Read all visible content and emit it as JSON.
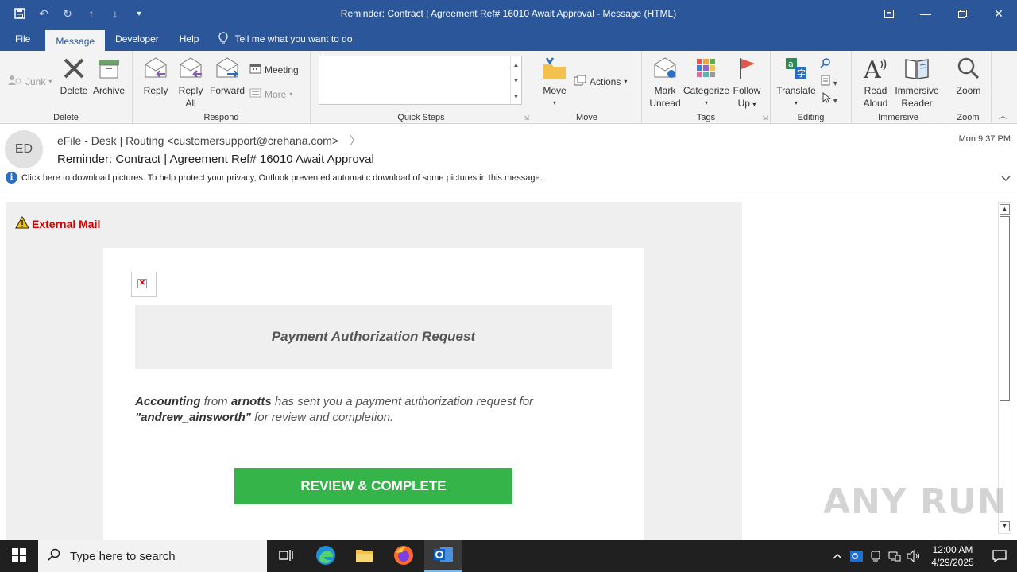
{
  "window": {
    "title": "Reminder:  Contract | Agreement Ref# 16010 Await Approval  -  Message (HTML)"
  },
  "ribbon_tabs": [
    "File",
    "Message",
    "Developer",
    "Help"
  ],
  "tell_me": "Tell me what you want to do",
  "ribbon": {
    "delete_group": {
      "label": "Delete",
      "junk": "Junk",
      "delete": "Delete",
      "archive": "Archive"
    },
    "respond_group": {
      "label": "Respond",
      "reply": "Reply",
      "reply_all_line1": "Reply",
      "reply_all_line2": "All",
      "forward": "Forward",
      "meeting": "Meeting",
      "more": "More"
    },
    "quick_steps_group": {
      "label": "Quick Steps"
    },
    "move_group": {
      "label": "Move",
      "move": "Move",
      "actions": "Actions"
    },
    "tags_group": {
      "label": "Tags",
      "mark_line1": "Mark",
      "mark_line2": "Unread",
      "categorize": "Categorize",
      "follow_line1": "Follow",
      "follow_line2": "Up"
    },
    "editing_group": {
      "label": "Editing",
      "translate": "Translate"
    },
    "immersive_group": {
      "label": "Immersive",
      "read_line1": "Read",
      "read_line2": "Aloud",
      "imm_line1": "Immersive",
      "imm_line2": "Reader"
    },
    "zoom_group": {
      "label": "Zoom",
      "zoom": "Zoom"
    }
  },
  "message": {
    "avatar_initials": "ED",
    "sender": "eFile - Desk | Routing <customersupport@crehana.com>",
    "subject": "Reminder:  Contract | Agreement Ref# 16010 Await Approval",
    "datetime": "Mon 9:37 PM",
    "info_bar": "Click here to download pictures. To help protect your privacy, Outlook prevented automatic download of some pictures in this message."
  },
  "body": {
    "external_mail": "External Mail",
    "payment_heading": "Payment Authorization Request",
    "text_sender": "Accounting",
    "text_from": " from ",
    "text_company": "arnotts",
    "text_middle": " has sent you a payment authorization request for ",
    "text_recipient": "\"andrew_ainsworth\"",
    "text_end": " for review and completion.",
    "button": "REVIEW & COMPLETE"
  },
  "watermark": "ANY RUN",
  "taskbar": {
    "search_placeholder": "Type here to search",
    "time": "12:00 AM",
    "date": "4/29/2025"
  },
  "colors": {
    "title_bar": "#2b579a",
    "review_button": "#35b44a",
    "external_mail": "#d40000"
  }
}
